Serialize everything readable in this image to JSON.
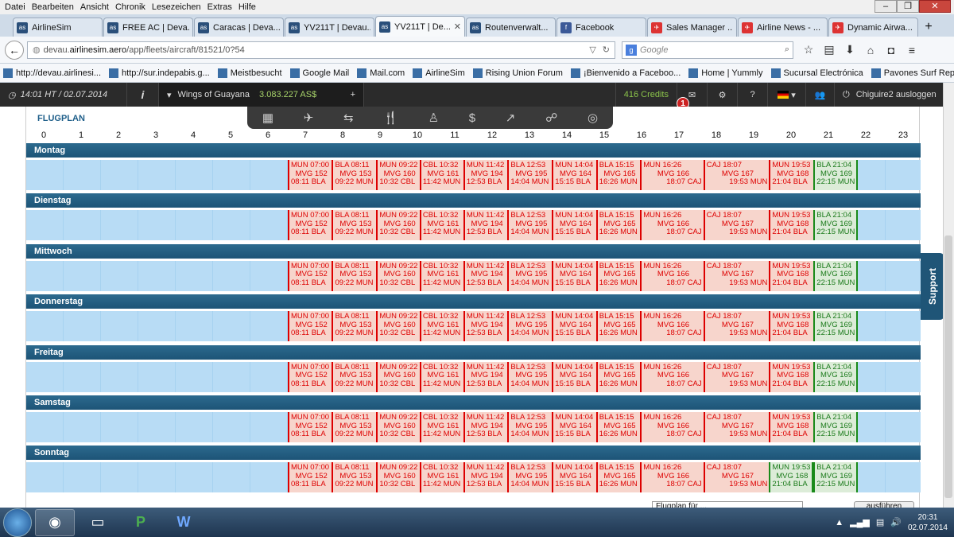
{
  "menubar": [
    "Datei",
    "Bearbeiten",
    "Ansicht",
    "Chronik",
    "Lesezeichen",
    "Extras",
    "Hilfe"
  ],
  "tabs": [
    {
      "label": "AirlineSim",
      "fav": "as"
    },
    {
      "label": "FREE AC | Deva...",
      "fav": "as"
    },
    {
      "label": "Caracas | Deva...",
      "fav": "as"
    },
    {
      "label": "YV211T | Devau...",
      "fav": "as"
    },
    {
      "label": "YV211T | De...",
      "fav": "as",
      "active": true
    },
    {
      "label": "Routenverwalt...",
      "fav": "as"
    },
    {
      "label": "Facebook",
      "fav": "f"
    },
    {
      "label": "Sales Manager ...",
      "fav": "sm"
    },
    {
      "label": "Airline News - ...",
      "fav": "an"
    },
    {
      "label": "Dynamic Airwa...",
      "fav": "da"
    }
  ],
  "url": {
    "pre": "devau.",
    "host": "airlinesim.aero",
    "path": "/app/fleets/aircraft/81521/0?54"
  },
  "search": {
    "placeholder": "Google"
  },
  "bookmarks": [
    "http://devau.airlinesi...",
    "http://sur.indepabis.g...",
    "Meistbesucht",
    "Google Mail",
    "Mail.com",
    "AirlineSim",
    "Rising Union Forum",
    "¡Bienvenido a Faceboo...",
    "Home | Yummly",
    "Sucursal Electrónica",
    "Pavones Surf Report"
  ],
  "appbar": {
    "time": "14:01 HT / 02.07.2014",
    "airline": "Wings of Guayana",
    "money": "3.083.227 AS$",
    "credits": "416 Credits",
    "badge": "1",
    "user": "Chiguire2 ausloggen"
  },
  "flugplan": {
    "title": "FLUGPLAN",
    "hours": [
      "0",
      "1",
      "2",
      "3",
      "4",
      "5",
      "6",
      "7",
      "8",
      "9",
      "10",
      "11",
      "12",
      "13",
      "14",
      "15",
      "16",
      "17",
      "18",
      "19",
      "20",
      "21",
      "22",
      "23"
    ]
  },
  "days": [
    "Montag",
    "Dienstag",
    "Mittwoch",
    "Donnerstag",
    "Freitag",
    "Samstag",
    "Sonntag"
  ],
  "flights": [
    {
      "dep": "MUN 07:00",
      "num": "MVG 152",
      "arr": "08:11 BLA",
      "start": 7.0,
      "end": 8.18
    },
    {
      "dep": "BLA 08:11",
      "num": "MVG 153",
      "arr": "09:22 MUN",
      "start": 8.18,
      "end": 9.37
    },
    {
      "dep": "MUN 09:22",
      "num": "MVG 160",
      "arr": "10:32 CBL",
      "start": 9.37,
      "end": 10.53
    },
    {
      "dep": "CBL 10:32",
      "num": "MVG 161",
      "arr": "11:42 MUN",
      "start": 10.53,
      "end": 11.7
    },
    {
      "dep": "MUN 11:42",
      "num": "MVG 194",
      "arr": "12:53 BLA",
      "start": 11.7,
      "end": 12.88
    },
    {
      "dep": "BLA 12:53",
      "num": "MVG 195",
      "arr": "14:04 MUN",
      "start": 12.88,
      "end": 14.07
    },
    {
      "dep": "MUN 14:04",
      "num": "MVG 164",
      "arr": "15:15 BLA",
      "start": 14.07,
      "end": 15.25
    },
    {
      "dep": "BLA 15:15",
      "num": "MVG 165",
      "arr": "16:26 MUN",
      "start": 15.25,
      "end": 16.43
    },
    {
      "dep": "MUN 16:26",
      "num": "MVG 166",
      "arr": "18:07 CAJ",
      "start": 16.43,
      "end": 18.12
    },
    {
      "dep": "CAJ 18:07",
      "num": "MVG 167",
      "arr": "19:53 MUN",
      "start": 18.12,
      "end": 19.88
    },
    {
      "dep": "MUN 19:53",
      "num": "MVG 168",
      "arr": "21:04 BLA",
      "start": 19.88,
      "end": 21.07
    },
    {
      "dep": "BLA 21:04",
      "num": "MVG 169",
      "arr": "22:15 MUN",
      "start": 21.07,
      "end": 22.25
    }
  ],
  "greenSunday": [
    10,
    11
  ],
  "greenOther": [
    11
  ],
  "support": "Support",
  "bottom": {
    "select": "Flugplan für ...",
    "button": "ausführen"
  },
  "taskbar": {
    "time": "20:31",
    "date": "02.07.2014"
  }
}
